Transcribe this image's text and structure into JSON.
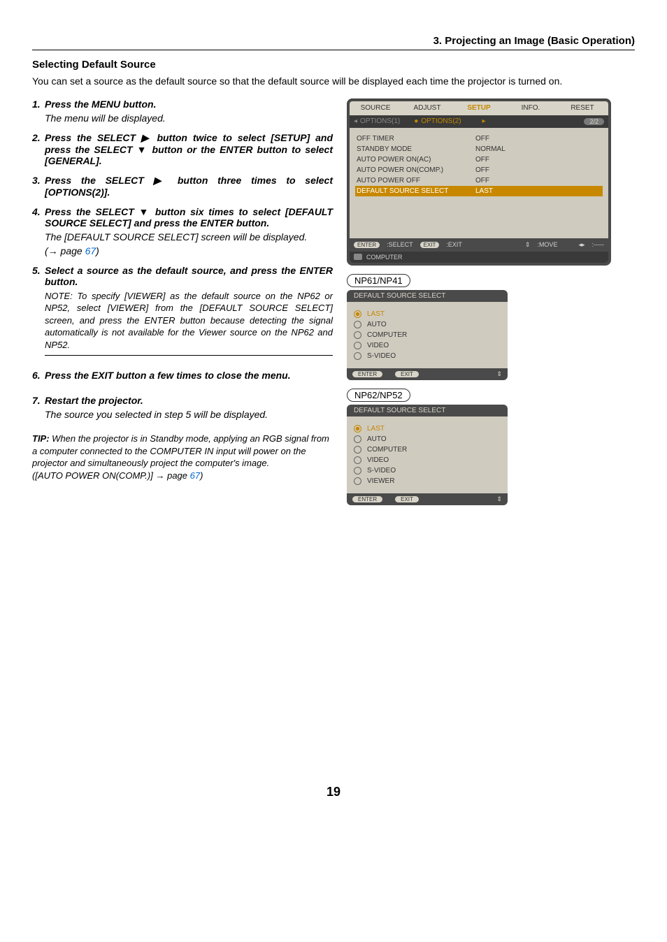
{
  "header": {
    "chapter": "3. Projecting an Image (Basic Operation)"
  },
  "section": {
    "title": "Selecting Default Source",
    "intro": "You can set a source as the default source so that the default source will be displayed each time the projector is turned on."
  },
  "steps": [
    {
      "num": "1.",
      "head": "Press the MENU button.",
      "sub": "The menu will be displayed."
    },
    {
      "num": "2.",
      "head": "Press the SELECT ▶ button twice to select [SETUP] and press the SELECT ▼ button or the ENTER button to select [GENERAL]."
    },
    {
      "num": "3.",
      "head": "Press the SELECT ▶ button three times to select [OPTIONS(2)]."
    },
    {
      "num": "4.",
      "head": "Press the SELECT ▼ button six times to select [DEFAULT SOURCE SELECT] and press the ENTER button.",
      "sub": "The [DEFAULT SOURCE SELECT] screen will be displayed.",
      "pageref_prefix": "(→ page ",
      "pageref": "67",
      "pageref_suffix": ")"
    },
    {
      "num": "5.",
      "head": "Select a source as the default source, and press the ENTER button.",
      "note": "NOTE: To specify [VIEWER] as the default source on the NP62 or NP52, select [VIEWER] from the [DEFAULT SOURCE SELECT] screen, and press the ENTER button because detecting the signal automatically is not available for the Viewer source on the NP62 and NP52."
    },
    {
      "num": "6.",
      "head": "Press the EXIT button a few times to close the menu."
    },
    {
      "num": "7.",
      "head": "Restart the projector.",
      "sub": "The source you selected in step 5 will be displayed."
    }
  ],
  "tip": {
    "label": "TIP:",
    "body": " When the projector is in Standby mode, applying an RGB signal from a computer connected to the COMPUTER IN input will power on the projector and simultaneously project the computer's image.",
    "ref_prefix": "([AUTO POWER ON(COMP.)] → page ",
    "ref": "67",
    "ref_suffix": ")"
  },
  "osd_main": {
    "tabs": [
      "SOURCE",
      "ADJUST",
      "SETUP",
      "INFO.",
      "RESET"
    ],
    "active_tab_index": 2,
    "subtab_left_glyph": "◂",
    "subtab1": "OPTIONS(1)",
    "subtab2_bullet": "●",
    "subtab2": "OPTIONS(2)",
    "subtab_right_glyph": "▸",
    "page_indicator": "2/2",
    "rows": [
      {
        "label": "OFF TIMER",
        "value": "OFF"
      },
      {
        "label": "STANDBY MODE",
        "value": "NORMAL"
      },
      {
        "label": "AUTO POWER ON(AC)",
        "value": "OFF"
      },
      {
        "label": "AUTO POWER ON(COMP.)",
        "value": "OFF"
      },
      {
        "label": "AUTO POWER OFF",
        "value": "OFF"
      },
      {
        "label": "DEFAULT SOURCE SELECT",
        "value": "LAST",
        "selected": true
      }
    ],
    "footer": {
      "enter_pill": "ENTER",
      "enter_lbl": ":SELECT",
      "exit_pill": "EXIT",
      "exit_lbl": ":EXIT",
      "move_glyph": "⇕",
      "move_lbl": ":MOVE",
      "lr_glyph": "◂▸",
      "lr_lbl": ":-----",
      "source": "COMPUTER"
    }
  },
  "model_a": {
    "label": "NP61/NP41"
  },
  "osd_small_a": {
    "title": "DEFAULT SOURCE SELECT",
    "items": [
      "LAST",
      "AUTO",
      "COMPUTER",
      "VIDEO",
      "S-VIDEO"
    ],
    "selected_index": 0,
    "enter": "ENTER",
    "exit": "EXIT",
    "updn": "⇕"
  },
  "model_b": {
    "label": "NP62/NP52"
  },
  "osd_small_b": {
    "title": "DEFAULT SOURCE SELECT",
    "items": [
      "LAST",
      "AUTO",
      "COMPUTER",
      "VIDEO",
      "S-VIDEO",
      "VIEWER"
    ],
    "selected_index": 0,
    "enter": "ENTER",
    "exit": "EXIT",
    "updn": "⇕"
  },
  "page_number": "19"
}
